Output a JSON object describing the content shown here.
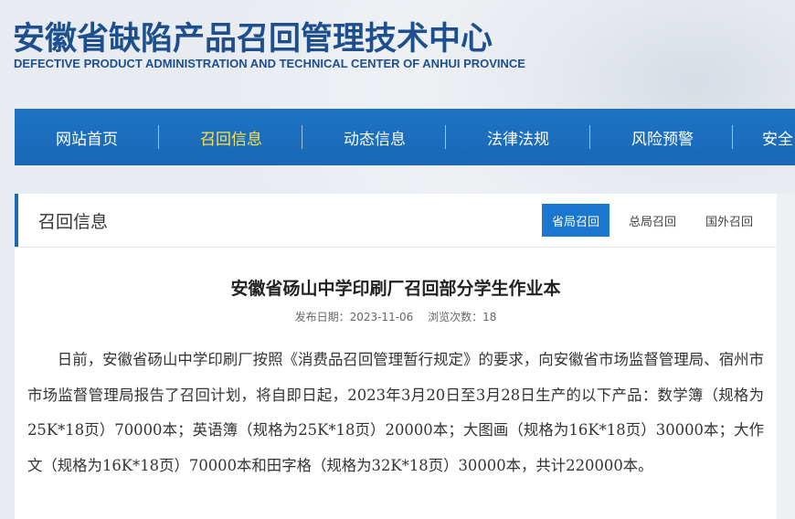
{
  "header": {
    "title": "安徽省缺陷产品召回管理技术中心",
    "subtitle": "DEFECTIVE PRODUCT ADMINISTRATION AND TECHNICAL CENTER OF ANHUI PROVINCE"
  },
  "nav": {
    "items": [
      {
        "label": "网站首页"
      },
      {
        "label": "召回信息"
      },
      {
        "label": "动态信息"
      },
      {
        "label": "法律法规"
      },
      {
        "label": "风险预警"
      },
      {
        "label": "安全"
      }
    ],
    "active_color": "#ffe24a",
    "bar_color": "#1a6ab8"
  },
  "panel": {
    "title": "召回信息",
    "tabs": [
      {
        "label": "省局召回"
      },
      {
        "label": "总局召回"
      },
      {
        "label": "国外召回"
      }
    ]
  },
  "article": {
    "title": "安徽省砀山中学印刷厂召回部分学生作业本",
    "publish_label": "发布日期：2023-11-06",
    "views_label": "浏览次数：18",
    "body": "日前，安徽省砀山中学印刷厂按照《消费品召回管理暂行规定》的要求，向安徽省市场监督管理局、宿州市市场监督管理局报告了召回计划，将自即日起，2023年3月20日至3月28日生产的以下产品：数学簿（规格为25K*18页）70000本；英语簿（规格为25K*18页）20000本；大图画（规格为16K*18页）30000本；大作文（规格为16K*18页）70000本和田字格（规格为32K*18页）30000本，共计220000本。"
  }
}
